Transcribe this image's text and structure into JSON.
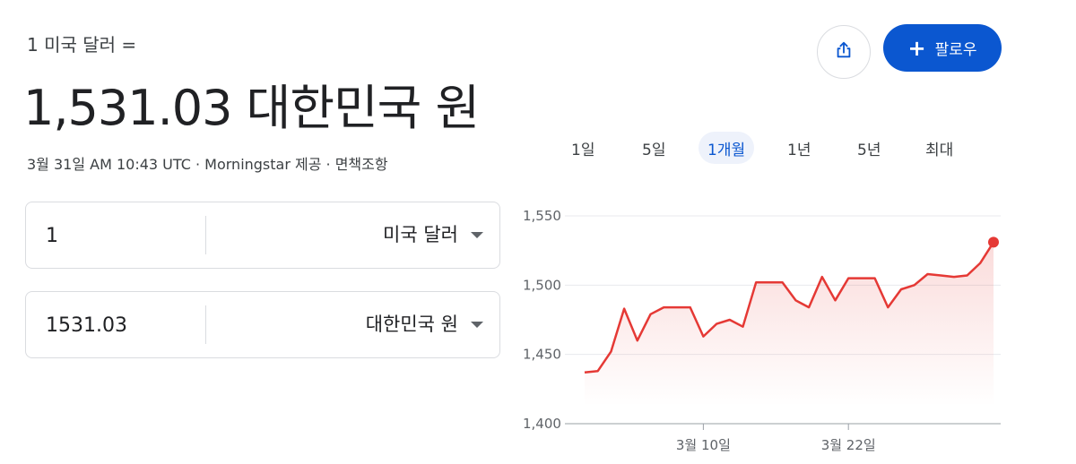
{
  "header": {
    "subtitle": "1 미국 달러 =",
    "rate": "1,531.03 대한민국 원",
    "meta": "3월 31일 AM 10:43 UTC · Morningstar 제공 · 면책조항"
  },
  "actions": {
    "share_icon": "share-icon",
    "follow_label": "팔로우",
    "follow_icon": "plus-icon",
    "accent_color": "#0b57d0"
  },
  "converter": {
    "from": {
      "amount": "1",
      "currency": "미국 달러"
    },
    "to": {
      "amount": "1531.03",
      "currency": "대한민국 원"
    }
  },
  "range_tabs": [
    {
      "label": "1일"
    },
    {
      "label": "5일"
    },
    {
      "label": "1개월",
      "active": true
    },
    {
      "label": "1년"
    },
    {
      "label": "5년"
    },
    {
      "label": "최대"
    }
  ],
  "chart_data": {
    "type": "area",
    "title": "",
    "xlabel": "",
    "ylabel": "",
    "ylim": [
      1400,
      1550
    ],
    "yticks": [
      "1,550",
      "1,500",
      "1,450",
      "1,400"
    ],
    "ytick_values": [
      1550,
      1500,
      1450,
      1400
    ],
    "xticks": [
      "3월 10일",
      "3월 22일"
    ],
    "xtick_indices": [
      9,
      20
    ],
    "series": [
      {
        "color": "#e53935",
        "values": [
          1437,
          1438,
          1452,
          1483,
          1460,
          1479,
          1484,
          1484,
          1484,
          1463,
          1472,
          1475,
          1470,
          1502,
          1502,
          1502,
          1489,
          1484,
          1506,
          1489,
          1505,
          1505,
          1505,
          1484,
          1497,
          1500,
          1508,
          1507,
          1506,
          1507,
          1516,
          1531
        ]
      }
    ],
    "grid": true
  }
}
